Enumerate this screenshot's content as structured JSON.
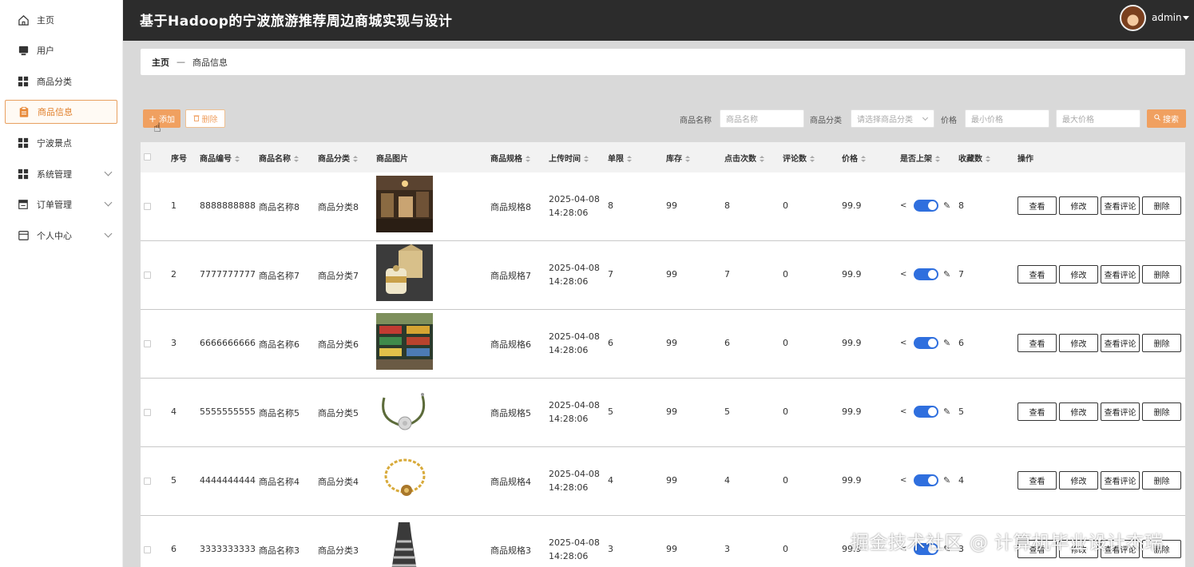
{
  "app_title": "基于Hadoop的宁波旅游推荐周边商城实现与设计",
  "user": {
    "name": "admin"
  },
  "sidebar": {
    "items": [
      {
        "label": "主页",
        "icon": "home-icon"
      },
      {
        "label": "用户",
        "icon": "user-icon"
      },
      {
        "label": "商品分类",
        "icon": "grid-icon"
      },
      {
        "label": "商品信息",
        "icon": "clipboard-icon",
        "active": true
      },
      {
        "label": "宁波景点",
        "icon": "grid-icon"
      },
      {
        "label": "系统管理",
        "icon": "grid-icon",
        "expandable": true
      },
      {
        "label": "订单管理",
        "icon": "list-icon",
        "expandable": true
      },
      {
        "label": "个人中心",
        "icon": "window-icon",
        "expandable": true
      }
    ]
  },
  "breadcrumb": {
    "home": "主页",
    "separator": "—",
    "current": "商品信息"
  },
  "toolbar": {
    "add_label": "添加",
    "delete_label": "删除",
    "search_label": "搜索",
    "filters": {
      "name_label": "商品名称",
      "name_placeholder": "商品名称",
      "category_label": "商品分类",
      "category_placeholder": "请选择商品分类",
      "price_label": "价格",
      "min_price_placeholder": "最小价格",
      "max_price_placeholder": "最大价格"
    }
  },
  "table": {
    "headers": {
      "index": "序号",
      "code": "商品编号",
      "name": "商品名称",
      "category": "商品分类",
      "image": "商品图片",
      "spec": "商品规格",
      "upload_time": "上传时间",
      "limit": "单限",
      "stock": "库存",
      "clicks": "点击次数",
      "comments": "评论数",
      "price": "价格",
      "on_shelf": "是否上架",
      "favorites": "收藏数",
      "actions": "操作"
    },
    "action_labels": {
      "view": "查看",
      "edit": "修改",
      "view_comments": "查看评论",
      "delete": "删除"
    },
    "rows": [
      {
        "index": "1",
        "code": "8888888888",
        "name": "商品名称8",
        "category": "商品分类8",
        "spec": "商品规格8",
        "upload_time": "2025-04-08 14:28:06",
        "limit": "8",
        "stock": "99",
        "clicks": "8",
        "comments": "0",
        "price": "99.9",
        "on_shelf": true,
        "favorites": "8",
        "image": "shop-interior"
      },
      {
        "index": "2",
        "code": "7777777777",
        "name": "商品名称7",
        "category": "商品分类7",
        "spec": "商品规格7",
        "upload_time": "2025-04-08 14:28:06",
        "limit": "7",
        "stock": "99",
        "clicks": "7",
        "comments": "0",
        "price": "99.9",
        "on_shelf": true,
        "favorites": "7",
        "image": "gift-box"
      },
      {
        "index": "3",
        "code": "6666666666",
        "name": "商品名称6",
        "category": "商品分类6",
        "spec": "商品规格6",
        "upload_time": "2025-04-08 14:28:06",
        "limit": "6",
        "stock": "99",
        "clicks": "6",
        "comments": "0",
        "price": "99.9",
        "on_shelf": true,
        "favorites": "6",
        "image": "store-shelves"
      },
      {
        "index": "4",
        "code": "5555555555",
        "name": "商品名称5",
        "category": "商品分类5",
        "spec": "商品规格5",
        "upload_time": "2025-04-08 14:28:06",
        "limit": "5",
        "stock": "99",
        "clicks": "5",
        "comments": "0",
        "price": "99.9",
        "on_shelf": true,
        "favorites": "5",
        "image": "bracelet-silver"
      },
      {
        "index": "5",
        "code": "4444444444",
        "name": "商品名称4",
        "category": "商品分类4",
        "spec": "商品规格4",
        "upload_time": "2025-04-08 14:28:06",
        "limit": "4",
        "stock": "99",
        "clicks": "4",
        "comments": "0",
        "price": "99.9",
        "on_shelf": true,
        "favorites": "4",
        "image": "bracelet-gold"
      },
      {
        "index": "6",
        "code": "3333333333",
        "name": "商品名称3",
        "category": "商品分类3",
        "spec": "商品规格3",
        "upload_time": "2025-04-08 14:28:06",
        "limit": "3",
        "stock": "99",
        "clicks": "3",
        "comments": "0",
        "price": "99.9",
        "on_shelf": true,
        "favorites": "3",
        "image": "striped-dress"
      }
    ]
  },
  "watermark": "掘金技术社区 @ 计算机毕业设计杰瑞"
}
